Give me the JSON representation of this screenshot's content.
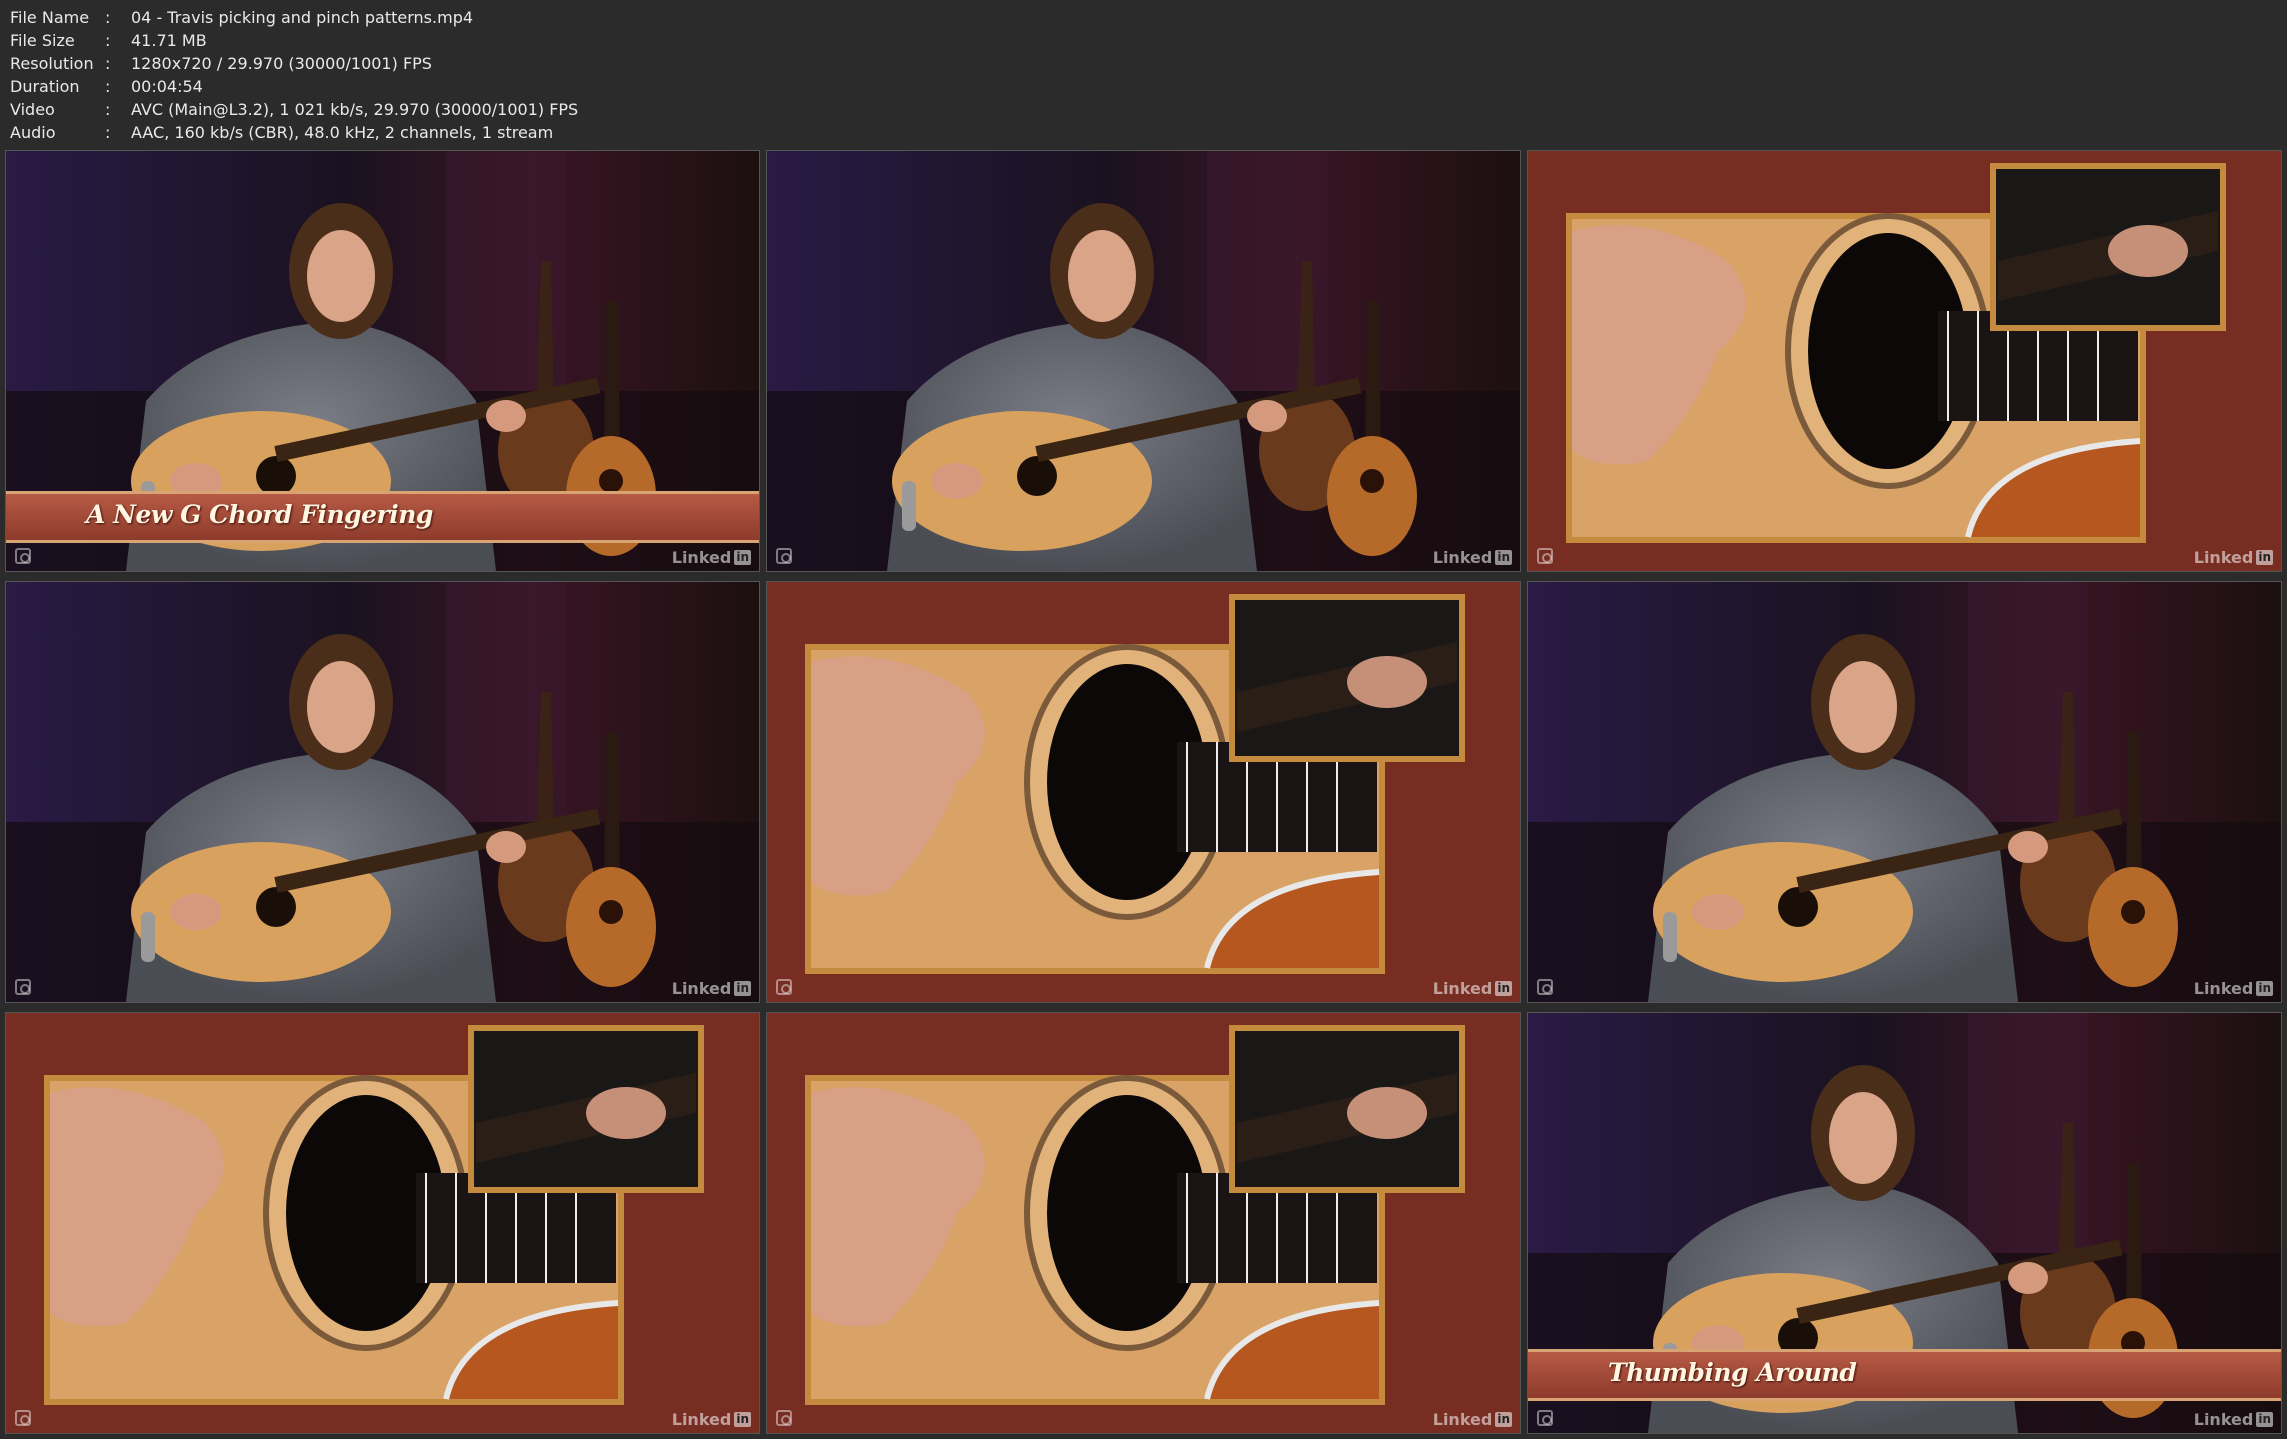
{
  "media_info": {
    "rows": [
      {
        "key": "File Name",
        "value": "04 - Travis picking and pinch patterns.mp4"
      },
      {
        "key": "File Size",
        "value": "41.71 MB"
      },
      {
        "key": "Resolution",
        "value": "1280x720 / 29.970 (30000/1001) FPS"
      },
      {
        "key": "Duration",
        "value": "00:04:54"
      },
      {
        "key": "Video",
        "value": "AVC (Main@L3.2), 1 021 kb/s, 29.970 (30000/1001) FPS"
      },
      {
        "key": "Audio",
        "value": "AAC, 160 kb/s (CBR), 48.0 kHz, 2 channels, 1 stream"
      }
    ]
  },
  "watermark": "Linked",
  "watermark_badge": "in",
  "thumbnails": [
    {
      "scene": "performer",
      "caption": "A New G Chord Fingering"
    },
    {
      "scene": "performer",
      "caption": ""
    },
    {
      "scene": "closeup",
      "caption": ""
    },
    {
      "scene": "performer",
      "caption": ""
    },
    {
      "scene": "closeup",
      "caption": ""
    },
    {
      "scene": "performer",
      "caption": ""
    },
    {
      "scene": "closeup",
      "caption": ""
    },
    {
      "scene": "closeup",
      "caption": ""
    },
    {
      "scene": "performer",
      "caption": "Thumbing Around"
    }
  ],
  "colors": {
    "background": "#2b2b2b",
    "header_text": "#e9e9e9",
    "studio_dark": "#1a1018",
    "studio_purple": "#3a2350",
    "closeup_red": "#7a2d22",
    "guitar_wood": "#d9a05a",
    "caption_bar": "#a44c3a"
  }
}
